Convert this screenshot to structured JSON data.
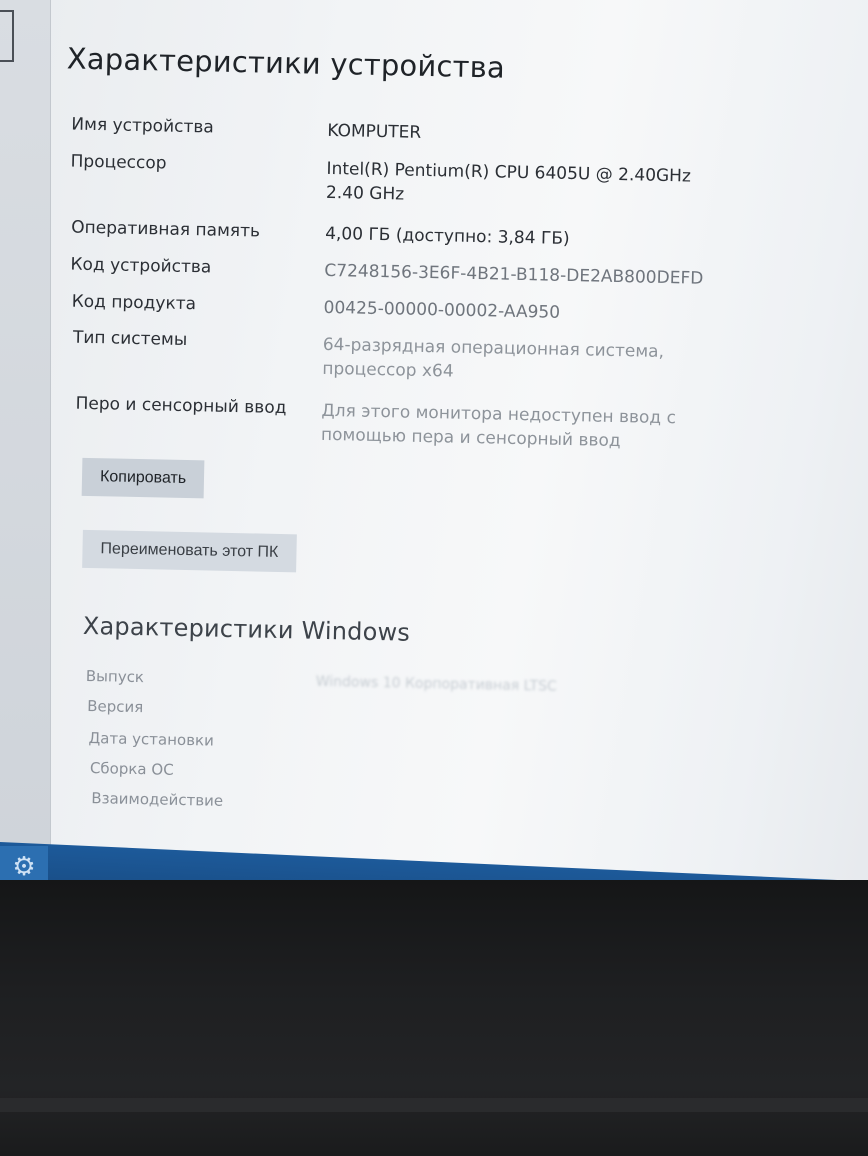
{
  "device_specs": {
    "title": "Характеристики устройства",
    "rows": [
      {
        "label": "Имя устройства",
        "value": "KOMPUTER"
      },
      {
        "label": "Процессор",
        "value": "Intel(R) Pentium(R) CPU 6405U @ 2.40GHz 2.40 GHz"
      },
      {
        "label": "Оперативная память",
        "value": "4,00 ГБ (доступно: 3,84 ГБ)"
      },
      {
        "label": "Код устройства",
        "value": "C7248156-3E6F-4B21-B118-DE2AB800DEFD"
      },
      {
        "label": "Код продукта",
        "value": "00425-00000-00002-AA950"
      },
      {
        "label": "Тип системы",
        "value": "64-разрядная операционная система, процессор x64"
      },
      {
        "label": "Перо и сенсорный ввод",
        "value": "Для этого монитора недоступен ввод с помощью пера и сенсорный ввод"
      }
    ],
    "copy_button": "Копировать",
    "rename_button": "Переименовать этот ПК"
  },
  "windows_specs": {
    "title": "Характеристики Windows",
    "rows": [
      {
        "label": "Выпуск",
        "value": "Windows 10 Корпоративная LTSC"
      },
      {
        "label": "Версия",
        "value": ""
      },
      {
        "label": "Дата установки",
        "value": ""
      },
      {
        "label": "Сборка ОС",
        "value": ""
      },
      {
        "label": "Взаимодействие",
        "value": ""
      }
    ]
  },
  "taskbar": {
    "settings_icon": "gear-icon",
    "accent_color": "#1d5a9a"
  }
}
